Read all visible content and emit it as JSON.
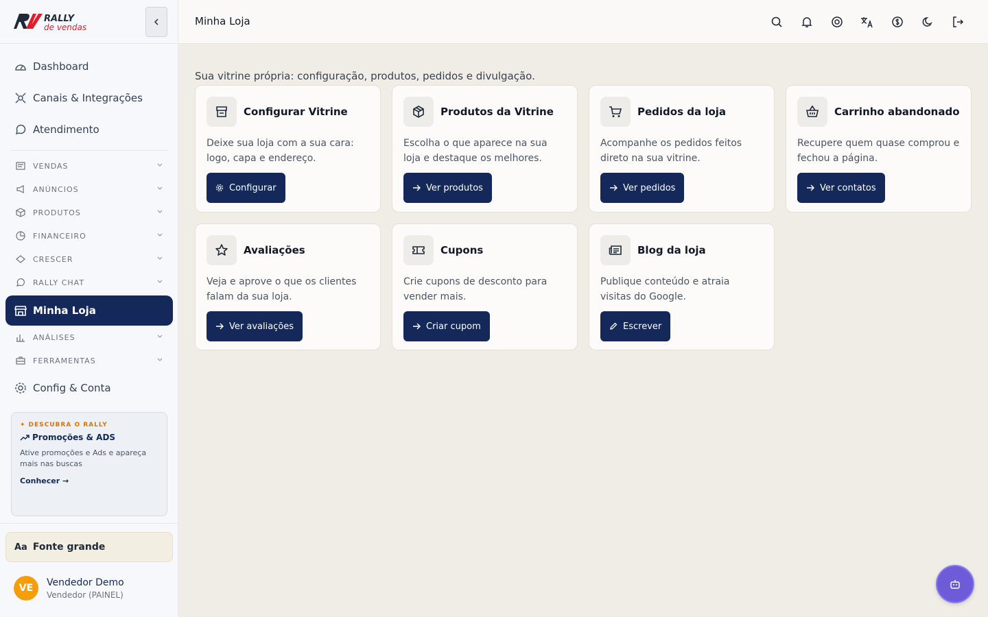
{
  "brand": {
    "logo_main": "RALLY",
    "logo_sub": "de vendas"
  },
  "topbar": {
    "title": "Minha Loja",
    "icons": [
      "search-icon",
      "bell-icon",
      "help-icon",
      "translate-icon",
      "currency-icon",
      "moon-icon",
      "logout-icon"
    ]
  },
  "sidebar": {
    "main_items": [
      {
        "label": "Dashboard",
        "icon": "dashboard-icon"
      },
      {
        "label": "Canais & Integrações",
        "icon": "integrations-icon"
      },
      {
        "label": "Atendimento",
        "icon": "chat-icon"
      }
    ],
    "sections": [
      {
        "label": "VENDAS",
        "icon": "list-icon"
      },
      {
        "label": "ANÚNCIOS",
        "icon": "megaphone-icon"
      },
      {
        "label": "PRODUTOS",
        "icon": "box-icon"
      },
      {
        "label": "FINANCEIRO",
        "icon": "finance-icon"
      },
      {
        "label": "CRESCER",
        "icon": "growth-icon"
      },
      {
        "label": "RALLY CHAT",
        "icon": "chat-icon"
      }
    ],
    "active_item": {
      "label": "Minha Loja",
      "icon": "store-icon"
    },
    "sections_after": [
      {
        "label": "ANÁLISES",
        "icon": "chart-icon"
      },
      {
        "label": "FERRAMENTAS",
        "icon": "toolbox-icon"
      }
    ],
    "config_item": {
      "label": "Config & Conta",
      "icon": "gear-icon"
    },
    "promo": {
      "kicker": "DESCUBRA O RALLY",
      "title": "Promoções & ADS",
      "description": "Ative promoções e Ads e apareça mais nas buscas",
      "link": "Conhecer →"
    },
    "font_button": {
      "icon_text": "Aa",
      "label": "Fonte grande"
    },
    "user": {
      "initials": "VE",
      "name": "Vendedor Demo",
      "role": "Vendedor (PAINEL)"
    }
  },
  "main": {
    "subtitle": "Sua vitrine própria: configuração, produtos, pedidos e divulgação.",
    "cards": [
      {
        "title": "Configurar Vitrine",
        "description": "Deixe sua loja com a sua cara: logo, capa e endereço.",
        "button": "Configurar",
        "icon": "storefront-icon",
        "button_icon": "gear-icon"
      },
      {
        "title": "Produtos da Vitrine",
        "description": "Escolha o que aparece na sua loja e destaque os melhores.",
        "button": "Ver produtos",
        "icon": "box-icon",
        "button_icon": "arrow-right-icon"
      },
      {
        "title": "Pedidos da loja",
        "description": "Acompanhe os pedidos feitos direto na sua vitrine.",
        "button": "Ver pedidos",
        "icon": "cart-icon",
        "button_icon": "arrow-right-icon"
      },
      {
        "title": "Carrinho abandonado",
        "description": "Recupere quem quase comprou e fechou a página.",
        "button": "Ver contatos",
        "icon": "basket-icon",
        "button_icon": "arrow-right-icon"
      },
      {
        "title": "Avaliações",
        "description": "Veja e aprove o que os clientes falam da sua loja.",
        "button": "Ver avaliações",
        "icon": "star-icon",
        "button_icon": "arrow-right-icon"
      },
      {
        "title": "Cupons",
        "description": "Crie cupons de desconto para vender mais.",
        "button": "Criar cupom",
        "icon": "ticket-icon",
        "button_icon": "arrow-right-icon"
      },
      {
        "title": "Blog da loja",
        "description": "Publique conteúdo e atraia visitas do Google.",
        "button": "Escrever",
        "icon": "newspaper-icon",
        "button_icon": "pencil-icon"
      }
    ]
  },
  "fab": {
    "icon": "bot-icon"
  },
  "colors": {
    "primary": "#14285a",
    "accent": "#f59e0b",
    "fab": "#6d5bd8"
  }
}
